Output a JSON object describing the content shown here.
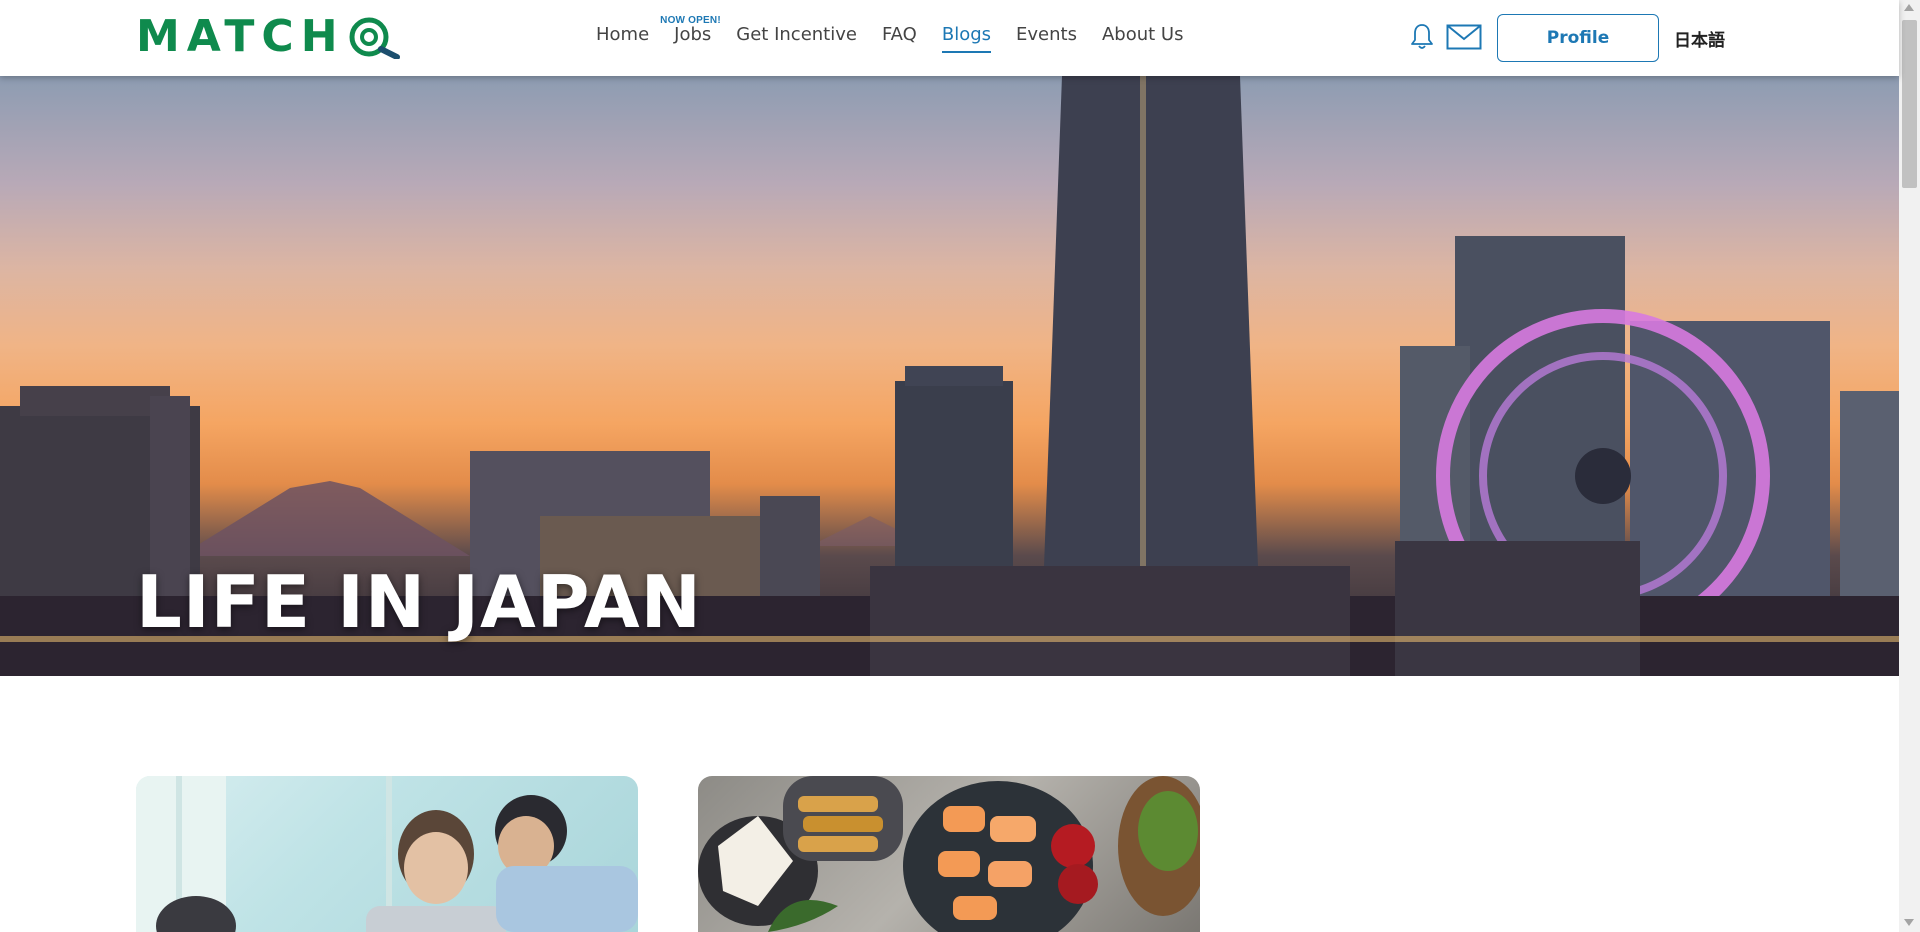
{
  "brand": {
    "logo_text": "MATCH",
    "logo_suffix": "@"
  },
  "nav": {
    "items": [
      {
        "label": "Home",
        "active": false
      },
      {
        "label": "Jobs",
        "active": false,
        "badge": "NOW OPEN!"
      },
      {
        "label": "Get Incentive",
        "active": false
      },
      {
        "label": "FAQ",
        "active": false
      },
      {
        "label": "Blogs",
        "active": true
      },
      {
        "label": "Events",
        "active": false
      },
      {
        "label": "About Us",
        "active": false
      }
    ]
  },
  "header_actions": {
    "bell_icon": "bell-icon",
    "mail_icon": "envelope-icon",
    "profile_label": "Profile",
    "language_label": "日本語"
  },
  "hero": {
    "title": "LIFE IN JAPAN"
  },
  "colors": {
    "brand_green": "#0f8a4d",
    "accent_blue": "#1d78b4"
  }
}
